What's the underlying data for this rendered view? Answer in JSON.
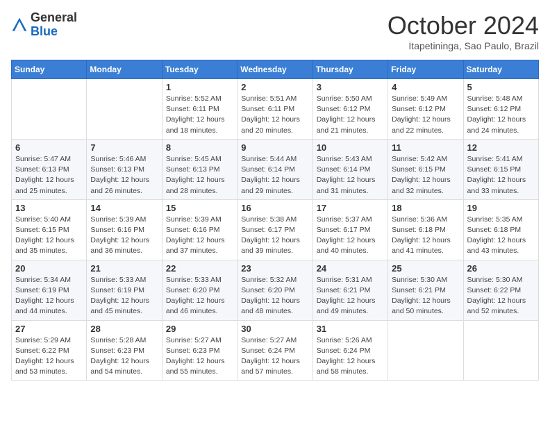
{
  "header": {
    "logo_general": "General",
    "logo_blue": "Blue",
    "month_title": "October 2024",
    "subtitle": "Itapetininga, Sao Paulo, Brazil"
  },
  "weekdays": [
    "Sunday",
    "Monday",
    "Tuesday",
    "Wednesday",
    "Thursday",
    "Friday",
    "Saturday"
  ],
  "weeks": [
    [
      {
        "day": "",
        "sunrise": "",
        "sunset": "",
        "daylight": ""
      },
      {
        "day": "",
        "sunrise": "",
        "sunset": "",
        "daylight": ""
      },
      {
        "day": "1",
        "sunrise": "Sunrise: 5:52 AM",
        "sunset": "Sunset: 6:11 PM",
        "daylight": "Daylight: 12 hours and 18 minutes."
      },
      {
        "day": "2",
        "sunrise": "Sunrise: 5:51 AM",
        "sunset": "Sunset: 6:11 PM",
        "daylight": "Daylight: 12 hours and 20 minutes."
      },
      {
        "day": "3",
        "sunrise": "Sunrise: 5:50 AM",
        "sunset": "Sunset: 6:12 PM",
        "daylight": "Daylight: 12 hours and 21 minutes."
      },
      {
        "day": "4",
        "sunrise": "Sunrise: 5:49 AM",
        "sunset": "Sunset: 6:12 PM",
        "daylight": "Daylight: 12 hours and 22 minutes."
      },
      {
        "day": "5",
        "sunrise": "Sunrise: 5:48 AM",
        "sunset": "Sunset: 6:12 PM",
        "daylight": "Daylight: 12 hours and 24 minutes."
      }
    ],
    [
      {
        "day": "6",
        "sunrise": "Sunrise: 5:47 AM",
        "sunset": "Sunset: 6:13 PM",
        "daylight": "Daylight: 12 hours and 25 minutes."
      },
      {
        "day": "7",
        "sunrise": "Sunrise: 5:46 AM",
        "sunset": "Sunset: 6:13 PM",
        "daylight": "Daylight: 12 hours and 26 minutes."
      },
      {
        "day": "8",
        "sunrise": "Sunrise: 5:45 AM",
        "sunset": "Sunset: 6:13 PM",
        "daylight": "Daylight: 12 hours and 28 minutes."
      },
      {
        "day": "9",
        "sunrise": "Sunrise: 5:44 AM",
        "sunset": "Sunset: 6:14 PM",
        "daylight": "Daylight: 12 hours and 29 minutes."
      },
      {
        "day": "10",
        "sunrise": "Sunrise: 5:43 AM",
        "sunset": "Sunset: 6:14 PM",
        "daylight": "Daylight: 12 hours and 31 minutes."
      },
      {
        "day": "11",
        "sunrise": "Sunrise: 5:42 AM",
        "sunset": "Sunset: 6:15 PM",
        "daylight": "Daylight: 12 hours and 32 minutes."
      },
      {
        "day": "12",
        "sunrise": "Sunrise: 5:41 AM",
        "sunset": "Sunset: 6:15 PM",
        "daylight": "Daylight: 12 hours and 33 minutes."
      }
    ],
    [
      {
        "day": "13",
        "sunrise": "Sunrise: 5:40 AM",
        "sunset": "Sunset: 6:15 PM",
        "daylight": "Daylight: 12 hours and 35 minutes."
      },
      {
        "day": "14",
        "sunrise": "Sunrise: 5:39 AM",
        "sunset": "Sunset: 6:16 PM",
        "daylight": "Daylight: 12 hours and 36 minutes."
      },
      {
        "day": "15",
        "sunrise": "Sunrise: 5:39 AM",
        "sunset": "Sunset: 6:16 PM",
        "daylight": "Daylight: 12 hours and 37 minutes."
      },
      {
        "day": "16",
        "sunrise": "Sunrise: 5:38 AM",
        "sunset": "Sunset: 6:17 PM",
        "daylight": "Daylight: 12 hours and 39 minutes."
      },
      {
        "day": "17",
        "sunrise": "Sunrise: 5:37 AM",
        "sunset": "Sunset: 6:17 PM",
        "daylight": "Daylight: 12 hours and 40 minutes."
      },
      {
        "day": "18",
        "sunrise": "Sunrise: 5:36 AM",
        "sunset": "Sunset: 6:18 PM",
        "daylight": "Daylight: 12 hours and 41 minutes."
      },
      {
        "day": "19",
        "sunrise": "Sunrise: 5:35 AM",
        "sunset": "Sunset: 6:18 PM",
        "daylight": "Daylight: 12 hours and 43 minutes."
      }
    ],
    [
      {
        "day": "20",
        "sunrise": "Sunrise: 5:34 AM",
        "sunset": "Sunset: 6:19 PM",
        "daylight": "Daylight: 12 hours and 44 minutes."
      },
      {
        "day": "21",
        "sunrise": "Sunrise: 5:33 AM",
        "sunset": "Sunset: 6:19 PM",
        "daylight": "Daylight: 12 hours and 45 minutes."
      },
      {
        "day": "22",
        "sunrise": "Sunrise: 5:33 AM",
        "sunset": "Sunset: 6:20 PM",
        "daylight": "Daylight: 12 hours and 46 minutes."
      },
      {
        "day": "23",
        "sunrise": "Sunrise: 5:32 AM",
        "sunset": "Sunset: 6:20 PM",
        "daylight": "Daylight: 12 hours and 48 minutes."
      },
      {
        "day": "24",
        "sunrise": "Sunrise: 5:31 AM",
        "sunset": "Sunset: 6:21 PM",
        "daylight": "Daylight: 12 hours and 49 minutes."
      },
      {
        "day": "25",
        "sunrise": "Sunrise: 5:30 AM",
        "sunset": "Sunset: 6:21 PM",
        "daylight": "Daylight: 12 hours and 50 minutes."
      },
      {
        "day": "26",
        "sunrise": "Sunrise: 5:30 AM",
        "sunset": "Sunset: 6:22 PM",
        "daylight": "Daylight: 12 hours and 52 minutes."
      }
    ],
    [
      {
        "day": "27",
        "sunrise": "Sunrise: 5:29 AM",
        "sunset": "Sunset: 6:22 PM",
        "daylight": "Daylight: 12 hours and 53 minutes."
      },
      {
        "day": "28",
        "sunrise": "Sunrise: 5:28 AM",
        "sunset": "Sunset: 6:23 PM",
        "daylight": "Daylight: 12 hours and 54 minutes."
      },
      {
        "day": "29",
        "sunrise": "Sunrise: 5:27 AM",
        "sunset": "Sunset: 6:23 PM",
        "daylight": "Daylight: 12 hours and 55 minutes."
      },
      {
        "day": "30",
        "sunrise": "Sunrise: 5:27 AM",
        "sunset": "Sunset: 6:24 PM",
        "daylight": "Daylight: 12 hours and 57 minutes."
      },
      {
        "day": "31",
        "sunrise": "Sunrise: 5:26 AM",
        "sunset": "Sunset: 6:24 PM",
        "daylight": "Daylight: 12 hours and 58 minutes."
      },
      {
        "day": "",
        "sunrise": "",
        "sunset": "",
        "daylight": ""
      },
      {
        "day": "",
        "sunrise": "",
        "sunset": "",
        "daylight": ""
      }
    ]
  ]
}
